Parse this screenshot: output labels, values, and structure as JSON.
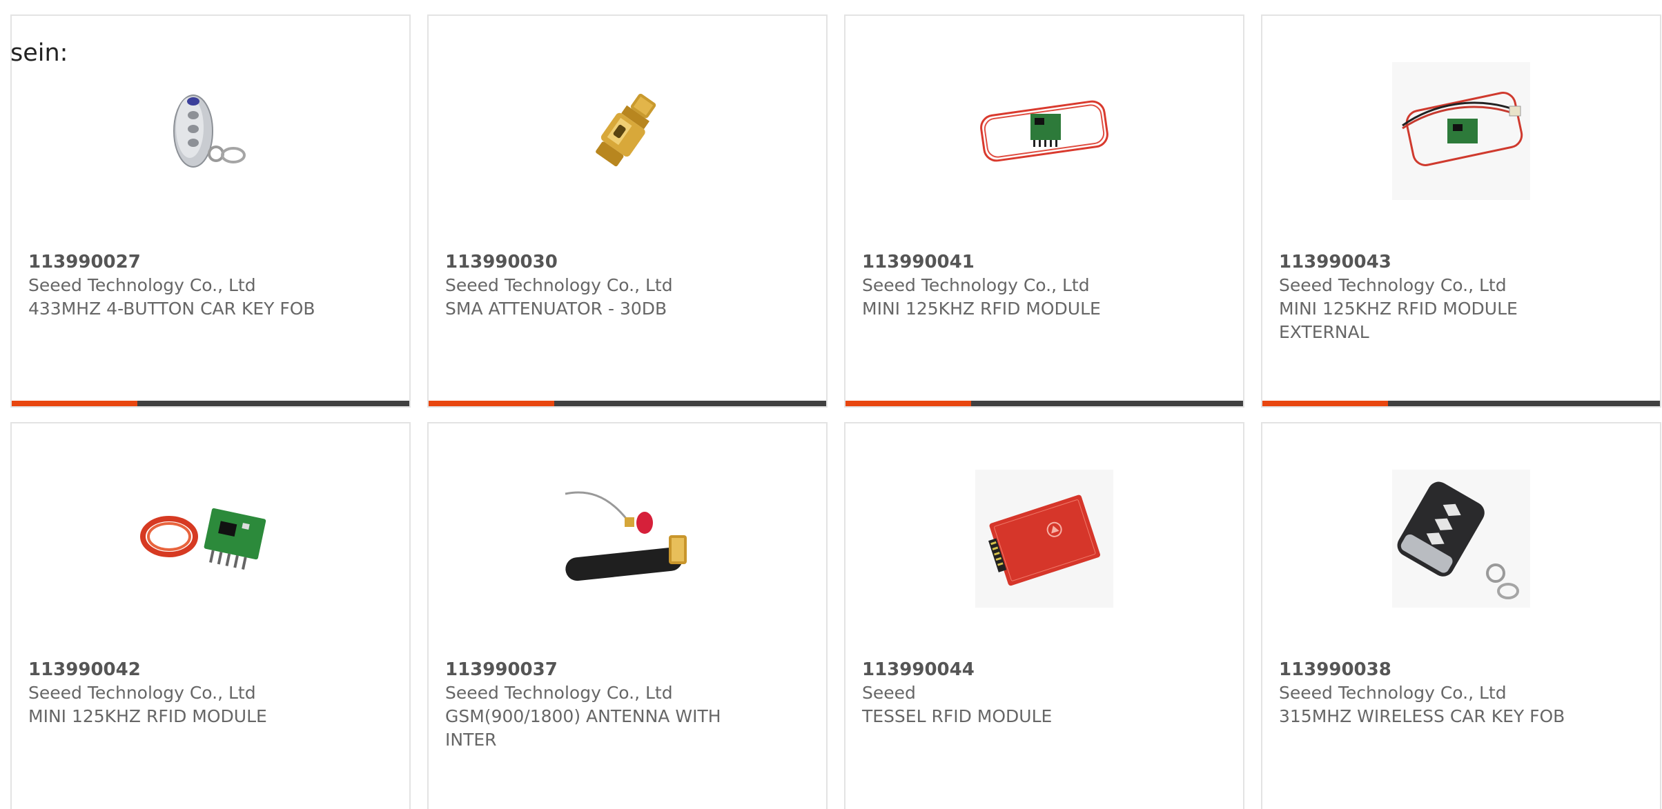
{
  "heading": "sein:",
  "colors": {
    "accent": "#e8460f",
    "bar": "#404040",
    "border": "#e3e3e3",
    "text": "#555555"
  },
  "products": [
    {
      "part": "113990027",
      "maker": "Seeed Technology Co., Ltd",
      "description": "433MHZ 4-BUTTON CAR KEY FOB",
      "icon": "car-key-fob-silver-image"
    },
    {
      "part": "113990030",
      "maker": "Seeed Technology Co., Ltd",
      "description": "SMA ATTENUATOR - 30DB",
      "icon": "sma-attenuator-image"
    },
    {
      "part": "113990041",
      "maker": "Seeed Technology Co., Ltd",
      "description": "MINI 125KHZ RFID MODULE",
      "icon": "rfid-module-loop-antenna-image"
    },
    {
      "part": "113990043",
      "maker": "Seeed Technology Co., Ltd",
      "description": "MINI 125KHZ RFID MODULE EXTERNAL",
      "icon": "rfid-module-external-antenna-image"
    },
    {
      "part": "113990042",
      "maker": "Seeed Technology Co., Ltd",
      "description": "MINI 125KHZ RFID MODULE",
      "icon": "rfid-module-coil-image"
    },
    {
      "part": "113990037",
      "maker": "Seeed Technology Co., Ltd",
      "description": "GSM(900/1800) ANTENNA WITH INTER",
      "icon": "gsm-antenna-image"
    },
    {
      "part": "113990044",
      "maker": "Seeed",
      "description": "TESSEL RFID MODULE",
      "icon": "tessel-rfid-board-image"
    },
    {
      "part": "113990038",
      "maker": "Seeed Technology Co., Ltd",
      "description": "315MHZ WIRELESS CAR KEY FOB",
      "icon": "car-key-fob-black-image"
    }
  ]
}
